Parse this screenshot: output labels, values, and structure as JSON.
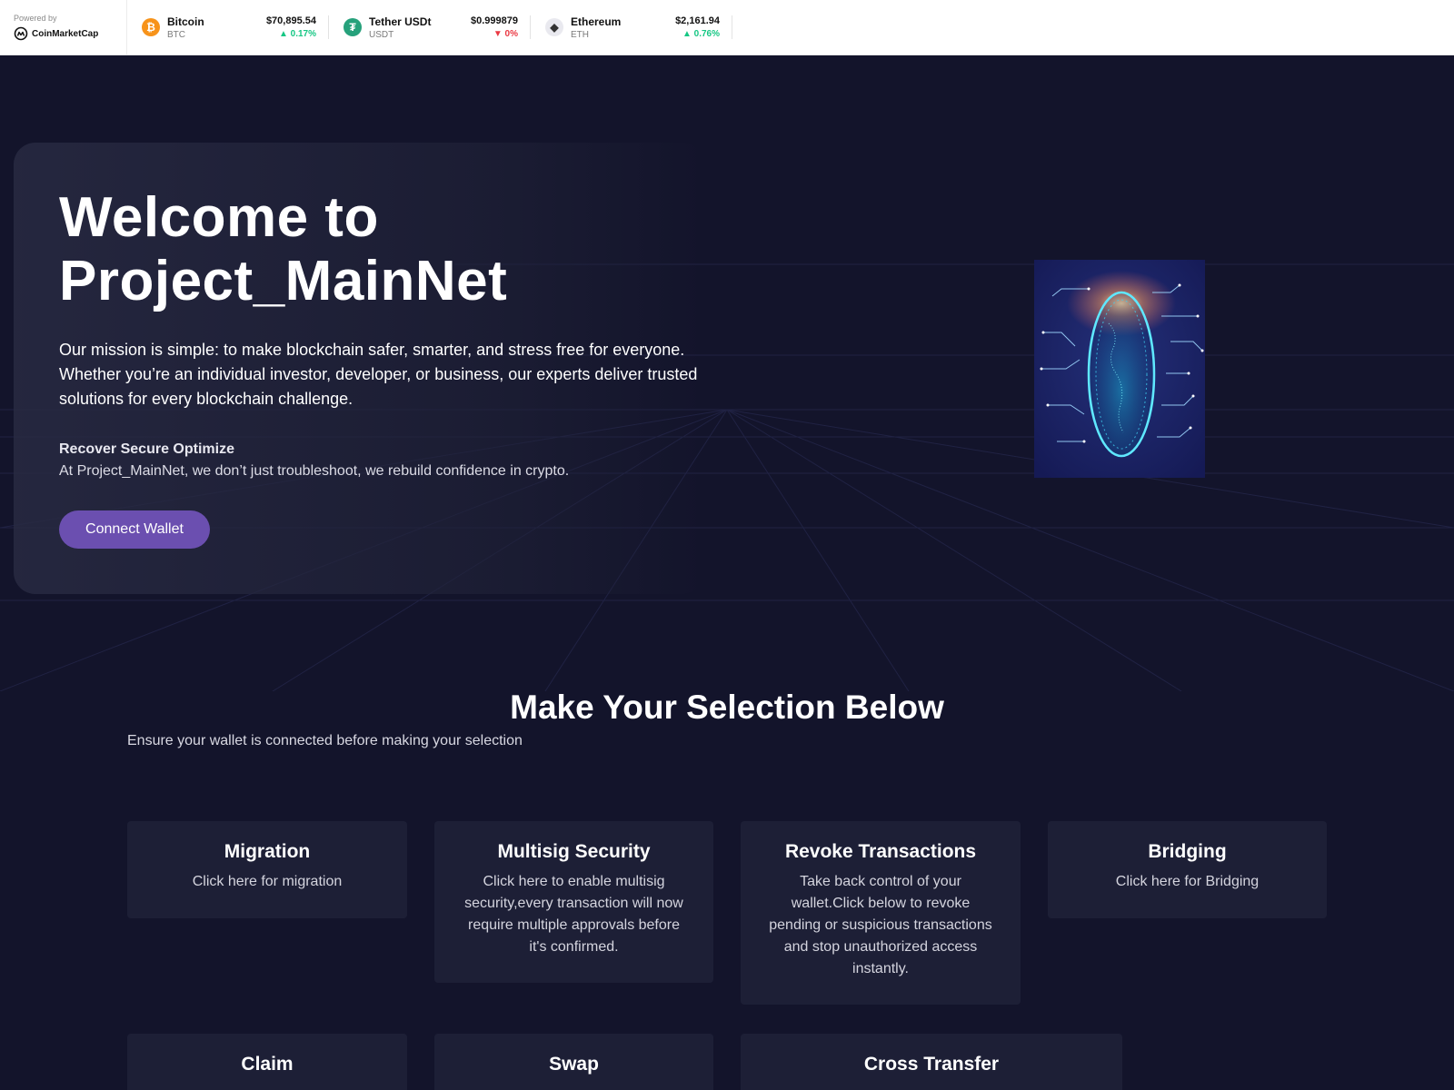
{
  "ticker": {
    "powered_by": "Powered by",
    "brand": "CoinMarketCap",
    "coins": [
      {
        "name": "Bitcoin",
        "symbol": "BTC",
        "price": "$70,895.54",
        "change": "0.17%",
        "direction": "up",
        "icon": "bitcoin-icon",
        "color": "#f7931a",
        "glyph": "₿"
      },
      {
        "name": "Tether USDt",
        "symbol": "USDT",
        "price": "$0.999879",
        "change": "0%",
        "direction": "down",
        "icon": "tether-icon",
        "color": "#26a17b",
        "glyph": "₮"
      },
      {
        "name": "Ethereum",
        "symbol": "ETH",
        "price": "$2,161.94",
        "change": "0.76%",
        "direction": "up",
        "icon": "ethereum-icon",
        "color": "#627eea",
        "glyph": "◆"
      }
    ]
  },
  "hero": {
    "title_line1": "Welcome to",
    "title_line2": "Project_MainNet",
    "description": "Our mission is simple: to make blockchain safer, smarter, and stress free for everyone. Whether you’re an individual investor, developer, or business, our experts deliver trusted solutions for every blockchain challenge.",
    "sub_title": "Recover Secure Optimize",
    "sub_text": "At Project_MainNet, we don’t just troubleshoot, we rebuild confidence in crypto.",
    "cta_label": "Connect Wallet",
    "accent": "#6b4fb0"
  },
  "selection": {
    "title": "Make Your Selection Below",
    "subtitle": "Ensure your wallet is connected before making your selection",
    "cards": [
      {
        "title": "Migration",
        "desc": "Click here for migration"
      },
      {
        "title": "Multisig Security",
        "desc": "Click here to enable multisig security,every transaction will now require multiple approvals before it's confirmed."
      },
      {
        "title": "Revoke Transactions",
        "desc": "Take back control of your wallet.Click below to revoke pending or suspicious transactions and stop unauthorized access instantly."
      },
      {
        "title": "Bridging",
        "desc": "Click here for Bridging"
      },
      {
        "title": "Claim",
        "desc": ""
      },
      {
        "title": "Swap",
        "desc": ""
      },
      {
        "title": "Cross Transfer",
        "desc": ""
      }
    ]
  }
}
